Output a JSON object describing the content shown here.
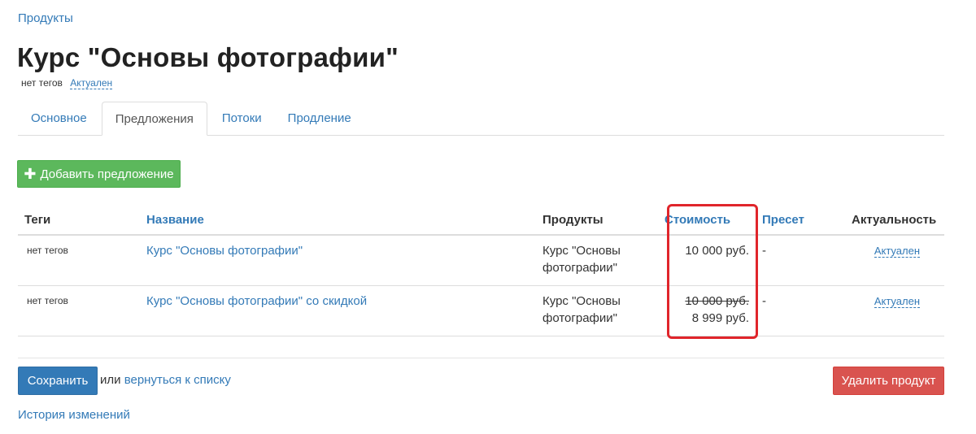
{
  "breadcrumb": {
    "label": "Продукты"
  },
  "page": {
    "title": "Курс \"Основы фотографии\"",
    "tags": "нет тегов",
    "status": "Актуален"
  },
  "tabs": [
    {
      "label": "Основное",
      "active": false
    },
    {
      "label": "Предложения",
      "active": true
    },
    {
      "label": "Потоки",
      "active": false
    },
    {
      "label": "Продление",
      "active": false
    }
  ],
  "add_button": {
    "label": "Добавить предложение",
    "icon": "plus-icon"
  },
  "table": {
    "headers": {
      "tags": "Теги",
      "name": "Название",
      "products": "Продукты",
      "price": "Стоимость",
      "preset": "Пресет",
      "activity": "Актуальность"
    },
    "rows": [
      {
        "tags": "нет тегов",
        "name": "Курс \"Основы фотографии\"",
        "products": "Курс \"Основы фотографии\"",
        "old_price": "",
        "price": "10 000 руб.",
        "preset": "-",
        "status": "Актуален"
      },
      {
        "tags": "нет тегов",
        "name": "Курс \"Основы фотографии\" со скидкой",
        "products": "Курс \"Основы фотографии\"",
        "old_price": "10 000 руб.",
        "price": "8 999 руб.",
        "preset": "-",
        "status": "Актуален"
      }
    ]
  },
  "footer": {
    "save": "Сохранить",
    "or": "или",
    "back": "вернуться к списку",
    "delete": "Удалить продукт",
    "history": "История изменений"
  },
  "colors": {
    "link": "#337ab7",
    "success": "#5cb85c",
    "primary": "#337ab7",
    "danger": "#d9534f",
    "highlight": "#e0252b"
  }
}
